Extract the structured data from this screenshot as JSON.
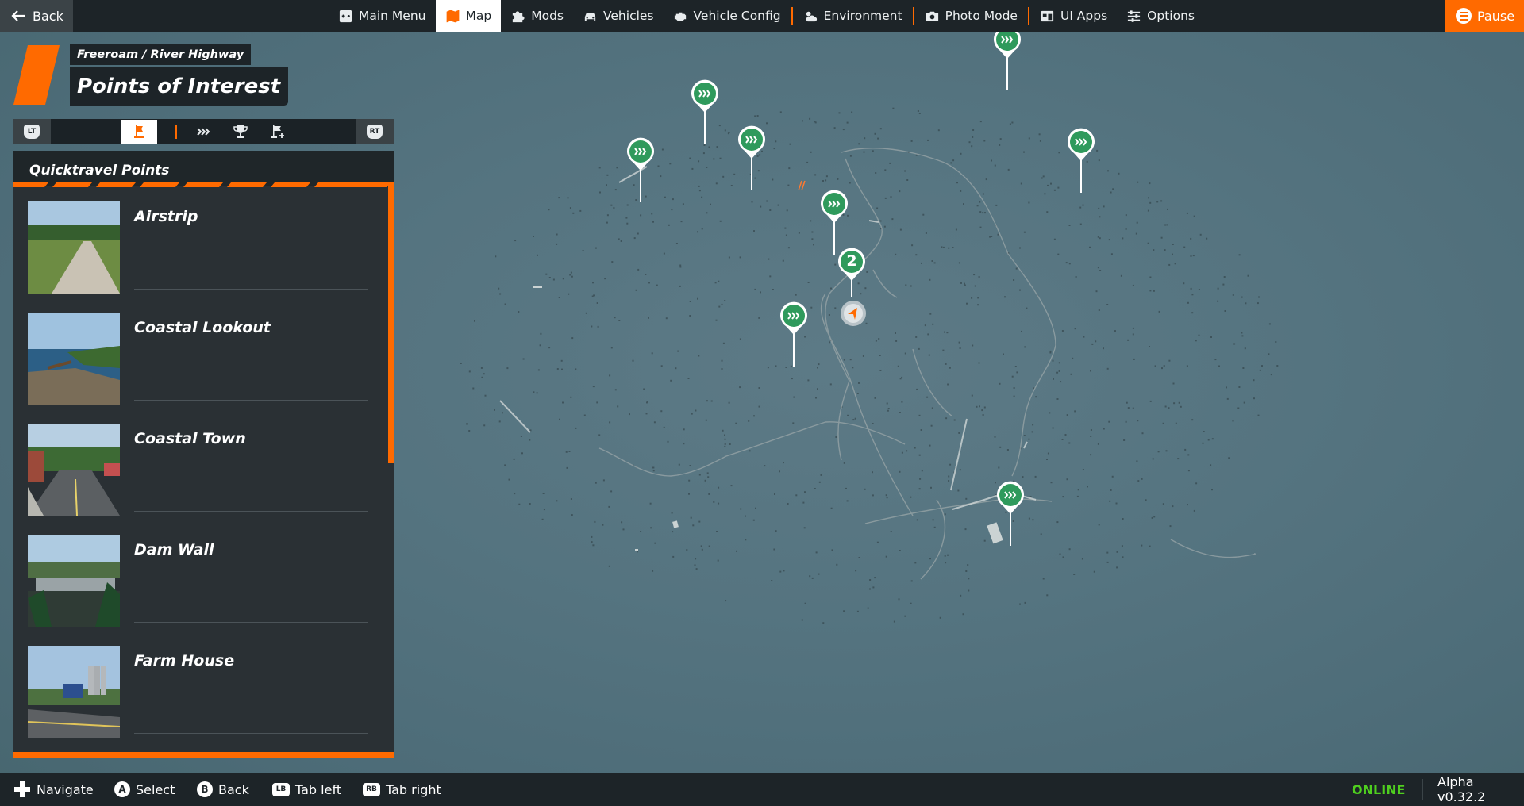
{
  "topbar": {
    "back_label": "Back",
    "menu": [
      {
        "label": "Main Menu",
        "icon": "main-menu-icon"
      },
      {
        "label": "Map",
        "icon": "map-icon",
        "active": true
      },
      {
        "label": "Mods",
        "icon": "puzzle-icon"
      },
      {
        "label": "Vehicles",
        "icon": "car-icon"
      },
      {
        "label": "Vehicle Config",
        "icon": "engine-icon"
      },
      {
        "label": "Environment",
        "icon": "weather-icon"
      },
      {
        "label": "Photo Mode",
        "icon": "camera-icon"
      },
      {
        "label": "UI Apps",
        "icon": "ui-apps-icon"
      },
      {
        "label": "Options",
        "icon": "sliders-icon"
      }
    ],
    "pause_label": "Pause"
  },
  "heading": {
    "breadcrumb": "Freeroam / River Highway",
    "title": "Points of Interest"
  },
  "tabs": {
    "left_bumper": "LT",
    "right_bumper": "RT",
    "icons": [
      "spawn-point-icon",
      "quicktravel-icon",
      "trophy-icon",
      "flag-add-icon"
    ],
    "active_index": 0
  },
  "panel": {
    "title": "Quicktravel Points",
    "items": [
      {
        "label": "Airstrip"
      },
      {
        "label": "Coastal Lookout"
      },
      {
        "label": "Coastal Town"
      },
      {
        "label": "Dam Wall"
      },
      {
        "label": "Farm House"
      }
    ]
  },
  "map": {
    "cluster_label": "2"
  },
  "bottombar": {
    "hints": [
      {
        "button": "",
        "label": "Navigate"
      },
      {
        "button": "A",
        "label": "Select"
      },
      {
        "button": "B",
        "label": "Back"
      },
      {
        "button": "LB",
        "label": "Tab left"
      },
      {
        "button": "RB",
        "label": "Tab right"
      }
    ],
    "status": "ONLINE",
    "version": "Alpha v0.32.2"
  },
  "colors": {
    "accent": "#ff6a00",
    "bar": "#1d2428",
    "online": "#4fcf1f",
    "poi_pin": "#2f9a5c"
  }
}
